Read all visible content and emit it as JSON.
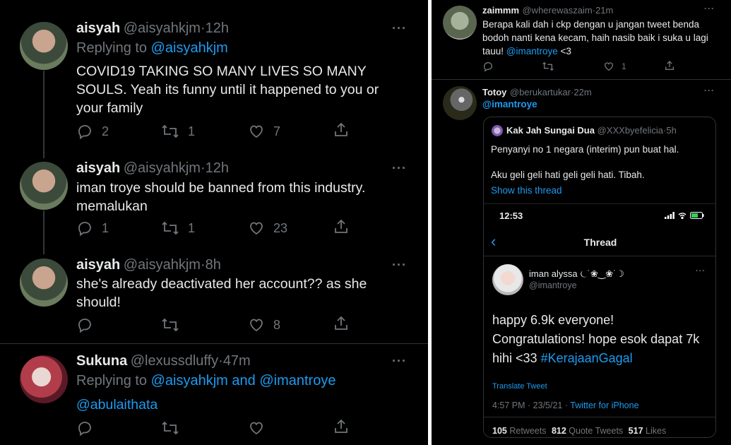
{
  "left": {
    "tweets": [
      {
        "name": "aisyah",
        "handle": "@aisyahkjm",
        "time": "12h",
        "reply_prefix": "Replying to",
        "reply_to": "@aisyahkjm",
        "text": "COVID19 TAKING SO MANY LIVES SO MANY SOULS. Yeah its funny until it happened to you or your family",
        "replies": "2",
        "retweets": "1",
        "likes": "7"
      },
      {
        "name": "aisyah",
        "handle": "@aisyahkjm",
        "time": "12h",
        "text": "iman troye should be banned from this industry. memalukan",
        "replies": "1",
        "retweets": "1",
        "likes": "23"
      },
      {
        "name": "aisyah",
        "handle": "@aisyahkjm",
        "time": "8h",
        "text": "she's already deactivated her account?? as she should!",
        "likes": "8"
      },
      {
        "name": "Sukuna",
        "handle": "@lexussdluffy",
        "time": "47m",
        "reply_prefix": "Replying to",
        "reply_to_1": "@aisyahkjm",
        "reply_and": "and",
        "reply_to_2": "@imantroye",
        "text": "@abulaithata"
      }
    ]
  },
  "right": {
    "tweet1": {
      "name": "zaimmm",
      "handle": "@wherewaszaim",
      "time": "21m",
      "text_pre": "Berapa kali dah i ckp dengan u jangan tweet benda bodoh nanti kena kecam, haih nasib baik i suka u lagi tauu! ",
      "mention": "@imantroye",
      "text_post": " <3",
      "likes": "1"
    },
    "tweet2": {
      "name": "Totoy",
      "handle": "@berukartukar",
      "time": "22m",
      "mention": "@imantroye"
    },
    "quote": {
      "name": "Kak Jah Sungai Dua",
      "handle": "@XXXbyefelicia",
      "time": "5h",
      "line1": "Penyanyi no 1 negara (interim) pun buat hal.",
      "line2": "Aku geli geli hati geli geli hati. Tibah.",
      "show_thread": "Show this thread"
    },
    "phone": {
      "clock": "12:53",
      "header": "Thread",
      "user_name": "iman alyssa ⏾˙❀‿❀˙☽",
      "user_handle": "@imantroye",
      "text1": "happy 6.9k everyone!",
      "text2": "Congratulations! hope esok dapat 7k",
      "text3": "hihi <33 ",
      "hashtag": "#KerajaanGagal",
      "translate": "Translate Tweet",
      "timestamp": "4:57 PM · 23/5/21 · ",
      "client": "Twitter for iPhone",
      "retweets_num": "105",
      "retweets_label": "Retweets",
      "quotes_num": "812",
      "quotes_label": "Quote Tweets",
      "likes_num": "517",
      "likes_label": "Likes"
    }
  }
}
